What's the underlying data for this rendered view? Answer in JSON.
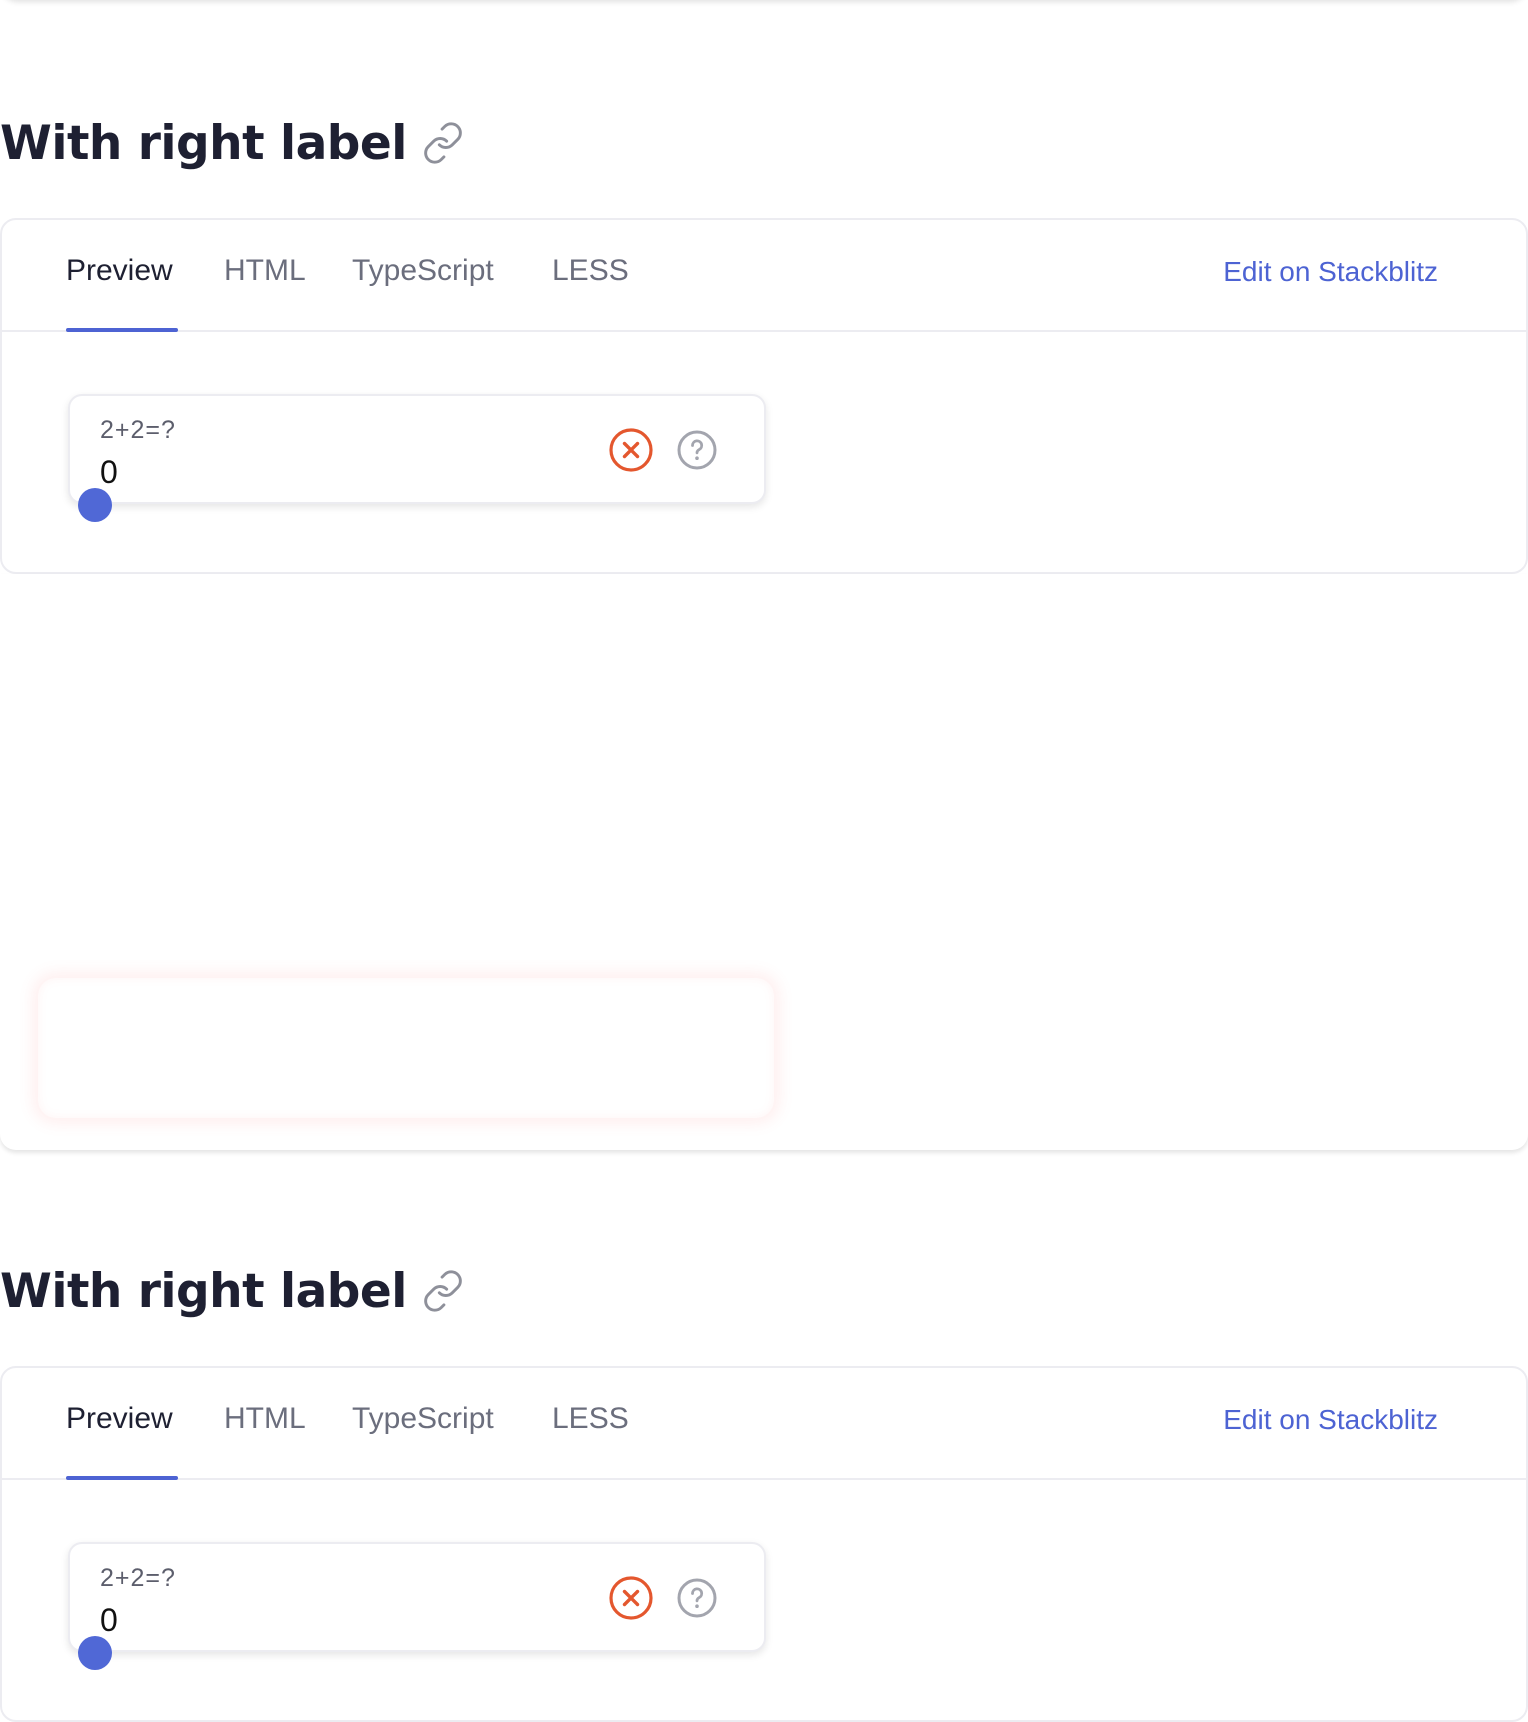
{
  "sections": [
    {
      "heading": "With right label",
      "tabs": [
        {
          "label": "Preview",
          "active": true
        },
        {
          "label": "HTML",
          "active": false
        },
        {
          "label": "TypeScript",
          "active": false
        },
        {
          "label": "LESS",
          "active": false
        }
      ],
      "edit_link": "Edit on Stackblitz",
      "field": {
        "label": "2+2=?",
        "value": "0"
      }
    },
    {
      "heading": "With right label",
      "tabs": [
        {
          "label": "Preview",
          "active": true
        },
        {
          "label": "HTML",
          "active": false
        },
        {
          "label": "TypeScript",
          "active": false
        },
        {
          "label": "LESS",
          "active": false
        }
      ],
      "edit_link": "Edit on Stackblitz",
      "field": {
        "label": "2+2=?",
        "value": "0"
      }
    }
  ],
  "icons": {
    "anchor": "link-icon",
    "error": "close-circle-icon",
    "help": "question-circle-icon"
  },
  "colors": {
    "accent": "#4d63d3",
    "error": "#e4572e",
    "help": "#a3a5ae",
    "heading": "#1e2032"
  }
}
